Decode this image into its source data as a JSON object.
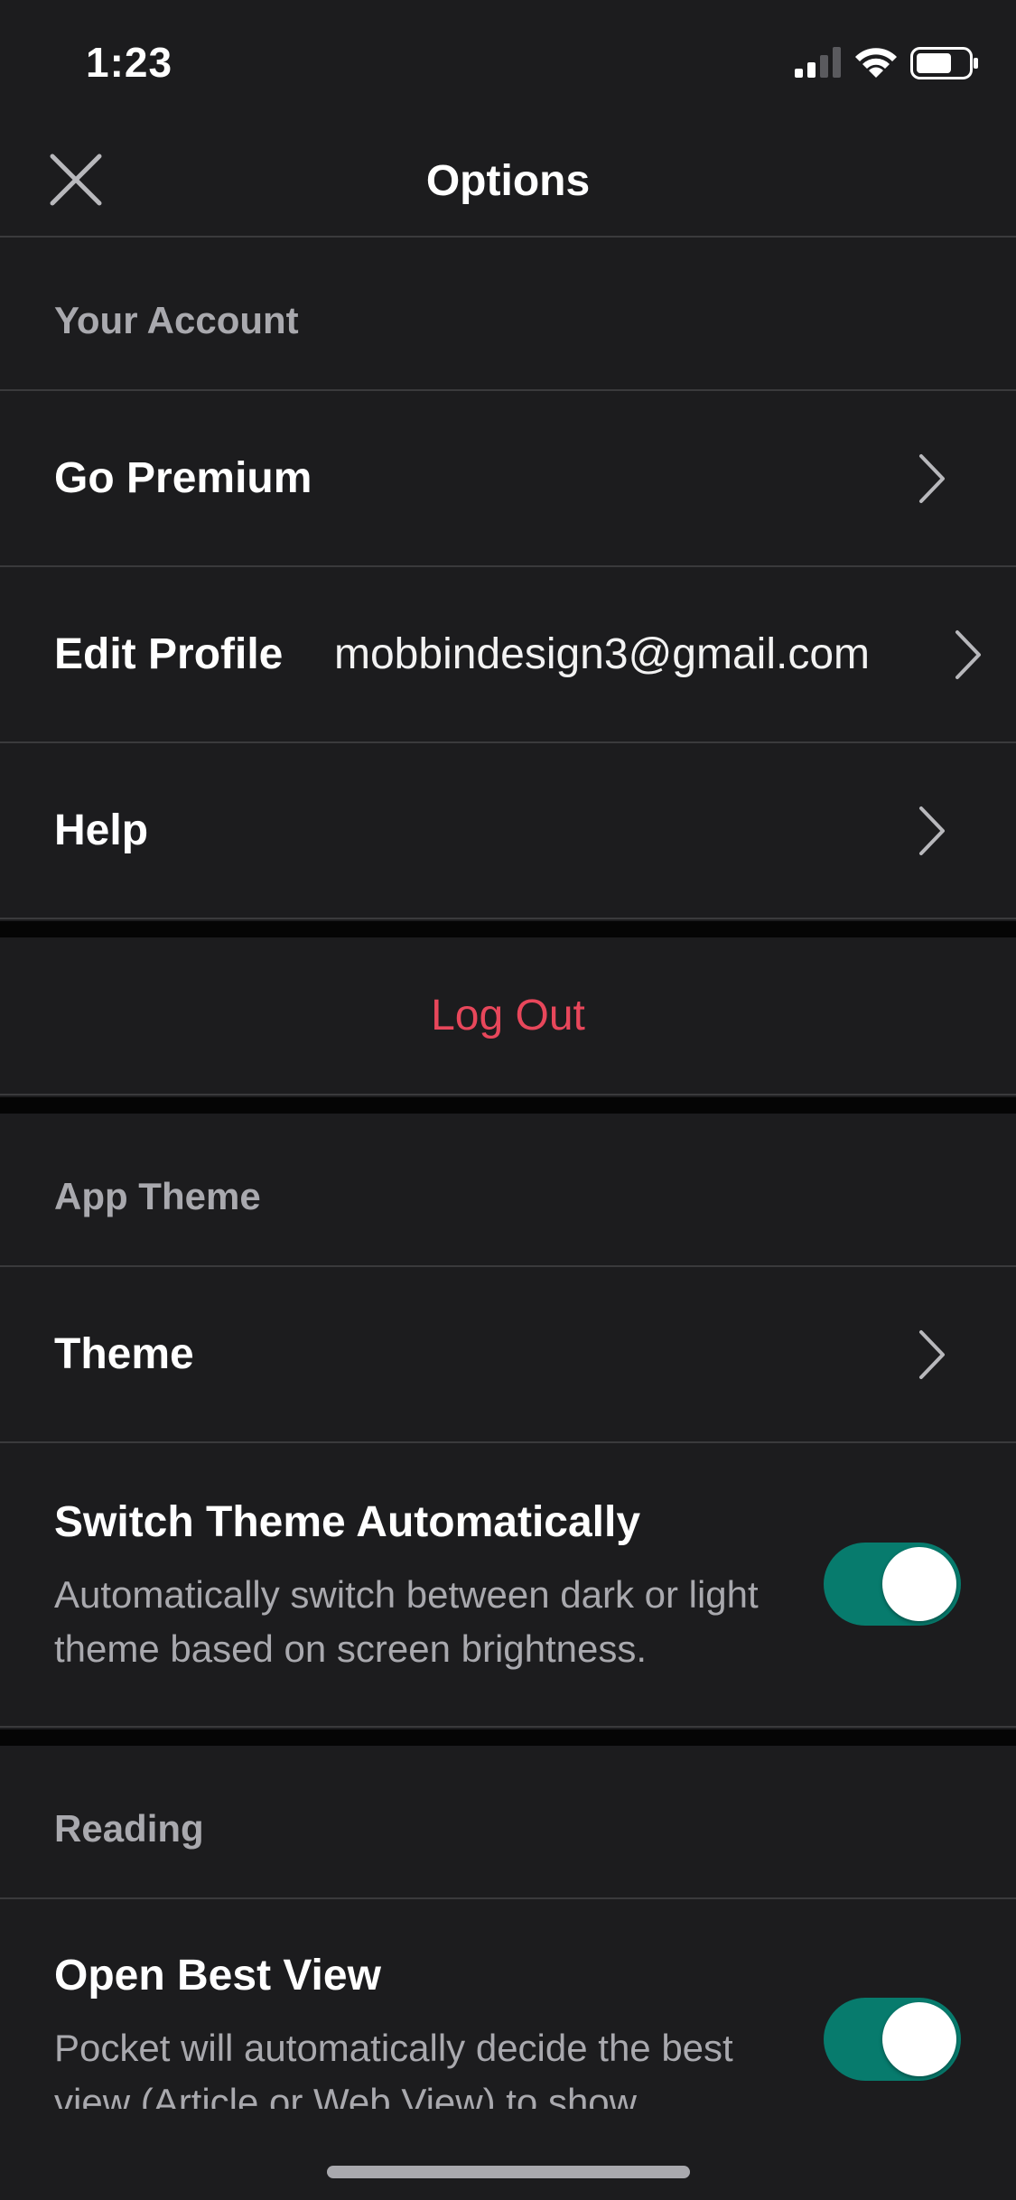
{
  "status_bar": {
    "time": "1:23",
    "icons": [
      "cellular-signal-icon",
      "wifi-icon",
      "battery-icon"
    ]
  },
  "nav": {
    "title": "Options",
    "close_icon": "close-icon"
  },
  "account": {
    "header": "Your Account",
    "go_premium": "Go Premium",
    "edit_profile": "Edit Profile",
    "email": "mobbindesign3@gmail.com",
    "help": "Help",
    "log_out": "Log Out"
  },
  "app_theme": {
    "header": "App Theme",
    "theme": "Theme",
    "switch_title": "Switch Theme Automatically",
    "switch_desc": "Automatically switch between dark or light theme based on screen brightness.",
    "switch_on": true
  },
  "reading": {
    "header": "Reading",
    "best_view_title": "Open Best View",
    "best_view_desc": "Pocket will automatically decide the best view (Article or Web View) to show",
    "best_view_on": true
  },
  "colors": {
    "background": "#1c1c1e",
    "accent_toggle": "#077b6d",
    "logout_red": "#e8475b",
    "secondary_text": "#a9a9ae"
  }
}
